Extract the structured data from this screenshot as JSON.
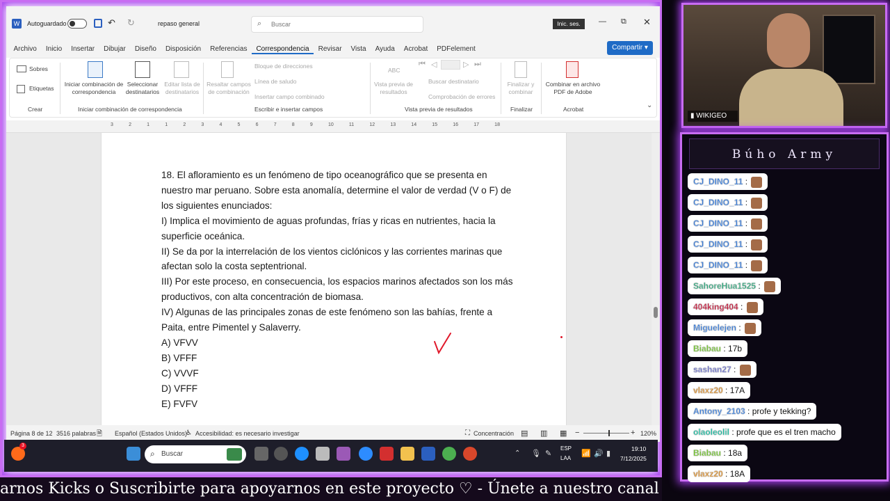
{
  "word": {
    "autosave_label": "Autoguardado",
    "doc_name": "repaso general",
    "search_placeholder": "Buscar",
    "signin_label": "Inic. ses.",
    "share_label": "Compartir",
    "tabs": [
      "Archivo",
      "Inicio",
      "Insertar",
      "Dibujar",
      "Diseño",
      "Disposición",
      "Referencias",
      "Correspondencia",
      "Revisar",
      "Vista",
      "Ayuda",
      "Acrobat",
      "PDFelement"
    ],
    "active_tab": "Correspondencia",
    "ribbon": {
      "crear": {
        "sobres": "Sobres",
        "etiquetas": "Etiquetas",
        "group": "Crear"
      },
      "iniciar": {
        "iniciar_label": "Iniciar combinación de correspondencia",
        "seleccionar": "Seleccionar destinatarios",
        "editar": "Editar lista de destinatarios",
        "group": "Iniciar combinación de correspondencia"
      },
      "escribir": {
        "resaltar": "Resaltar campos de combinación",
        "bloque": "Bloque de direcciones",
        "linea": "Línea de saludo",
        "insertar": "Insertar campo combinado",
        "group": "Escribir e insertar campos"
      },
      "vista": {
        "vista_previa": "Vista previa de resultados",
        "abc": "ABC",
        "buscar": "Buscar destinatario",
        "comprobacion": "Comprobación de errores",
        "group": "Vista previa de resultados"
      },
      "finalizar": {
        "label": "Finalizar y combinar",
        "group": "Finalizar"
      },
      "acrobat": {
        "label": "Combinar en archivo PDF de Adobe",
        "group": "Acrobat"
      }
    },
    "ruler_marks": [
      "3",
      "2",
      "1",
      "1",
      "2",
      "3",
      "4",
      "5",
      "6",
      "7",
      "8",
      "9",
      "10",
      "11",
      "12",
      "13",
      "14",
      "15",
      "16",
      "17",
      "18"
    ],
    "doc_lines": [
      "18. El afloramiento es un fenómeno de tipo oceanográfico que se presenta en",
      "nuestro mar peruano. Sobre esta anomalía, determine el valor de verdad (V o F) de",
      "los siguientes enunciados:",
      "I) Implica el movimiento de aguas profundas, frías y ricas en nutrientes, hacia la",
      "superficie oceánica.",
      "II) Se da por la interrelación de los vientos ciclónicos y las corrientes marinas que",
      "afectan solo la costa septentrional.",
      "III) Por este proceso, en consecuencia, los espacios marinos afectados son los más",
      "productivos, con alta concentración de biomasa.",
      "IV) Algunas de las principales zonas de este fenómeno son las bahías, frente a",
      "Paita, entre Pimentel y Salaverry.",
      "A) VFVV",
      "B) VFFF",
      "C) VVVF",
      "D) VFFF",
      "E) FVFV"
    ],
    "status": {
      "page": "Página 8 de 12",
      "words": "3516 palabras",
      "language": "Español (Estados Unidos)",
      "accessibility": "Accesibilidad: es necesario investigar",
      "focus": "Concentración",
      "zoom": "120%"
    }
  },
  "taskbar": {
    "search_placeholder": "Buscar",
    "lang_top": "ESP",
    "lang_bottom": "LAA",
    "time": "19:10",
    "date": "7/12/2025",
    "badge": "3"
  },
  "cam": {
    "channel_label": "WIKIGEO"
  },
  "chat": {
    "title": "Búho Army",
    "messages": [
      {
        "user": "CJ_DINO_11",
        "text": "",
        "color": "#3a7bd5",
        "emote": true
      },
      {
        "user": "CJ_DINO_11",
        "text": "",
        "color": "#3a7bd5",
        "emote": true
      },
      {
        "user": "CJ_DINO_11",
        "text": "",
        "color": "#3a7bd5",
        "emote": true
      },
      {
        "user": "CJ_DINO_11",
        "text": "",
        "color": "#3a7bd5",
        "emote": true
      },
      {
        "user": "CJ_DINO_11",
        "text": "",
        "color": "#3a7bd5",
        "emote": true
      },
      {
        "user": "SahoreHua1525",
        "text": "",
        "color": "#2fa37a",
        "emote": true
      },
      {
        "user": "404king404",
        "text": "",
        "color": "#c0183a",
        "emote": true
      },
      {
        "user": "Miguelejen",
        "text": "",
        "color": "#3a7bd5",
        "emote": true
      },
      {
        "user": "Biabau",
        "text": "17b",
        "color": "#6fbf2e",
        "emote": false
      },
      {
        "user": "sashan27",
        "text": "",
        "color": "#6a6fc7",
        "emote": true
      },
      {
        "user": "vlaxz20",
        "text": "17A",
        "color": "#d38a2c",
        "emote": false
      },
      {
        "user": "Antony_2103",
        "text": "profe y tekking?",
        "color": "#3a7bd5",
        "emote": false
      },
      {
        "user": "olaoleolil",
        "text": "profe que es el tren macho",
        "color": "#17b79c",
        "emote": false
      },
      {
        "user": "Biabau",
        "text": "18a",
        "color": "#6fbf2e",
        "emote": false
      },
      {
        "user": "vlaxz20",
        "text": "18A",
        "color": "#d38a2c",
        "emote": false
      }
    ]
  },
  "ticker": {
    "text": "arnos Kicks o Suscribirte para apoyarnos en este proyecto ♡  -  Únete a nuestro canal con el L"
  }
}
